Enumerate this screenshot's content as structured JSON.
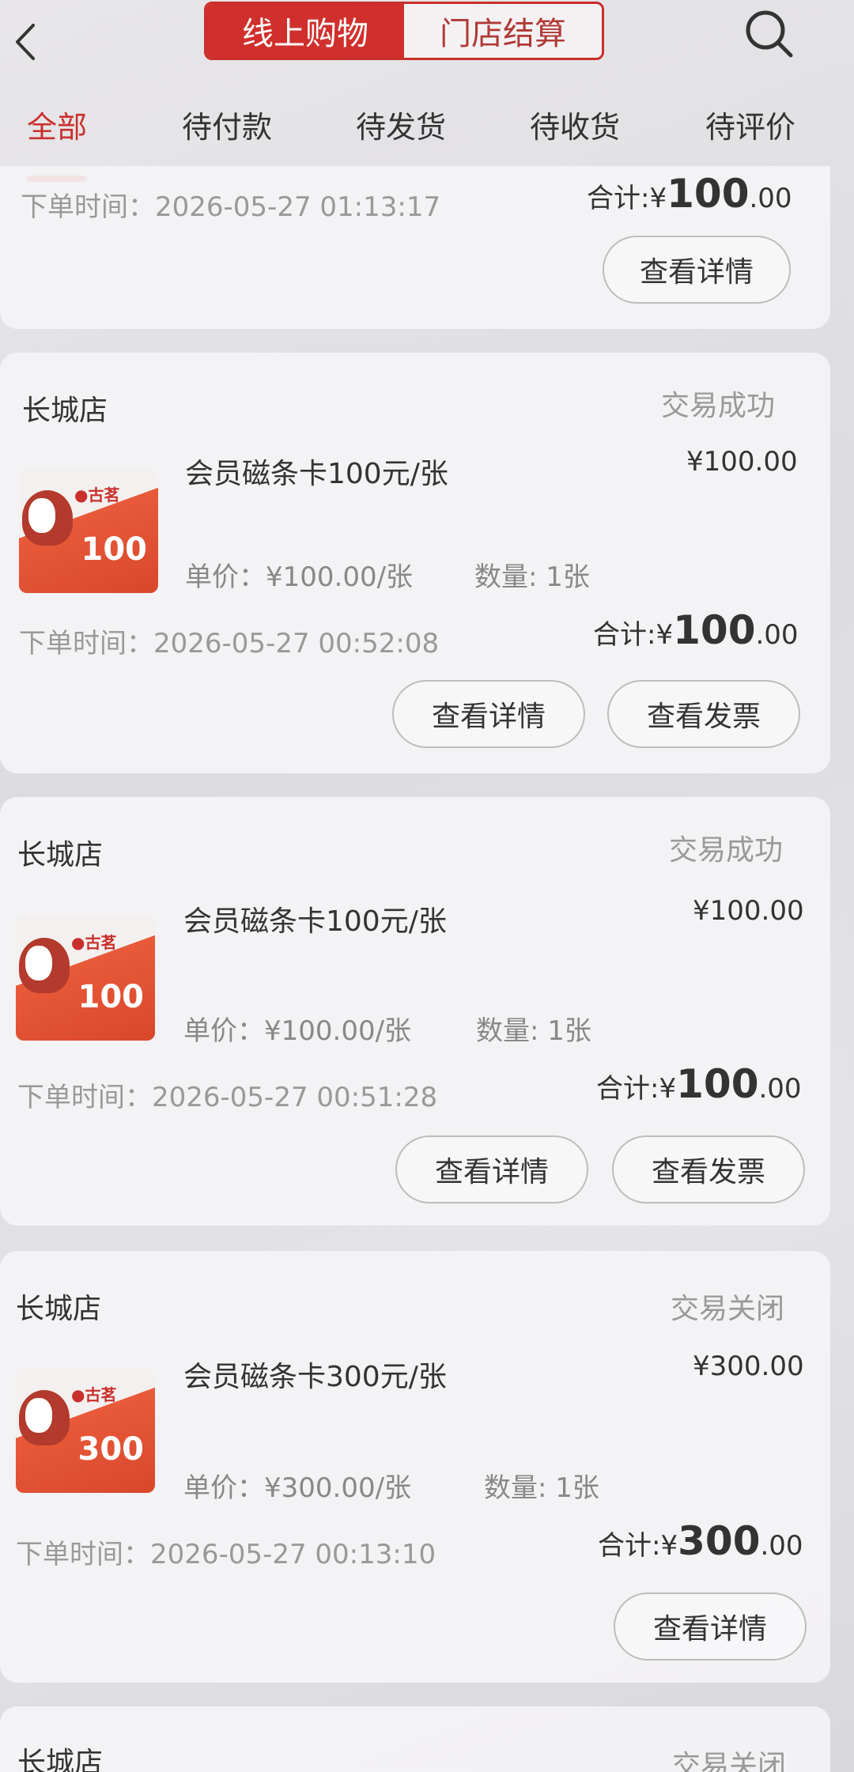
{
  "header": {
    "segments": [
      "线上购物",
      "门店结算"
    ],
    "active_segment": 0
  },
  "tabs": [
    "全部",
    "待付款",
    "待发货",
    "待收货",
    "待评价"
  ],
  "active_tab": 0,
  "top_order": {
    "time_label": "下单时间：",
    "time": "2026-05-27 01:13:17",
    "total_label": "合计:",
    "currency": "¥",
    "total_int": "100",
    "total_dec": ".00",
    "buttons": [
      "查看详情"
    ]
  },
  "orders": [
    {
      "store": "长城店",
      "status": "交易成功",
      "product_name": "会员磁条卡100元/张",
      "price": "¥100.00",
      "unit_price": "单价：¥100.00/张",
      "quantity": "数量: 1张",
      "card_amount": "100",
      "time_label": "下单时间：",
      "time": "2026-05-27 00:52:08",
      "total_label": "合计:",
      "currency": "¥",
      "total_int": "100",
      "total_dec": ".00",
      "buttons": [
        "查看详情",
        "查看发票"
      ]
    },
    {
      "store": "长城店",
      "status": "交易成功",
      "product_name": "会员磁条卡100元/张",
      "price": "¥100.00",
      "unit_price": "单价：¥100.00/张",
      "quantity": "数量: 1张",
      "card_amount": "100",
      "time_label": "下单时间：",
      "time": "2026-05-27 00:51:28",
      "total_label": "合计:",
      "currency": "¥",
      "total_int": "100",
      "total_dec": ".00",
      "buttons": [
        "查看详情",
        "查看发票"
      ]
    },
    {
      "store": "长城店",
      "status": "交易关闭",
      "product_name": "会员磁条卡300元/张",
      "price": "¥300.00",
      "unit_price": "单价：¥300.00/张",
      "quantity": "数量: 1张",
      "card_amount": "300",
      "time_label": "下单时间：",
      "time": "2026-05-27 00:13:10",
      "total_label": "合计:",
      "currency": "¥",
      "total_int": "300",
      "total_dec": ".00",
      "buttons": [
        "查看详情"
      ]
    }
  ],
  "partial_order": {
    "store": "长城店",
    "status": "交易关闭"
  },
  "icons": {
    "back": "chevron-left-icon",
    "search": "search-icon"
  },
  "colors": {
    "accent": "#d0302c",
    "status_gray": "#999999"
  }
}
